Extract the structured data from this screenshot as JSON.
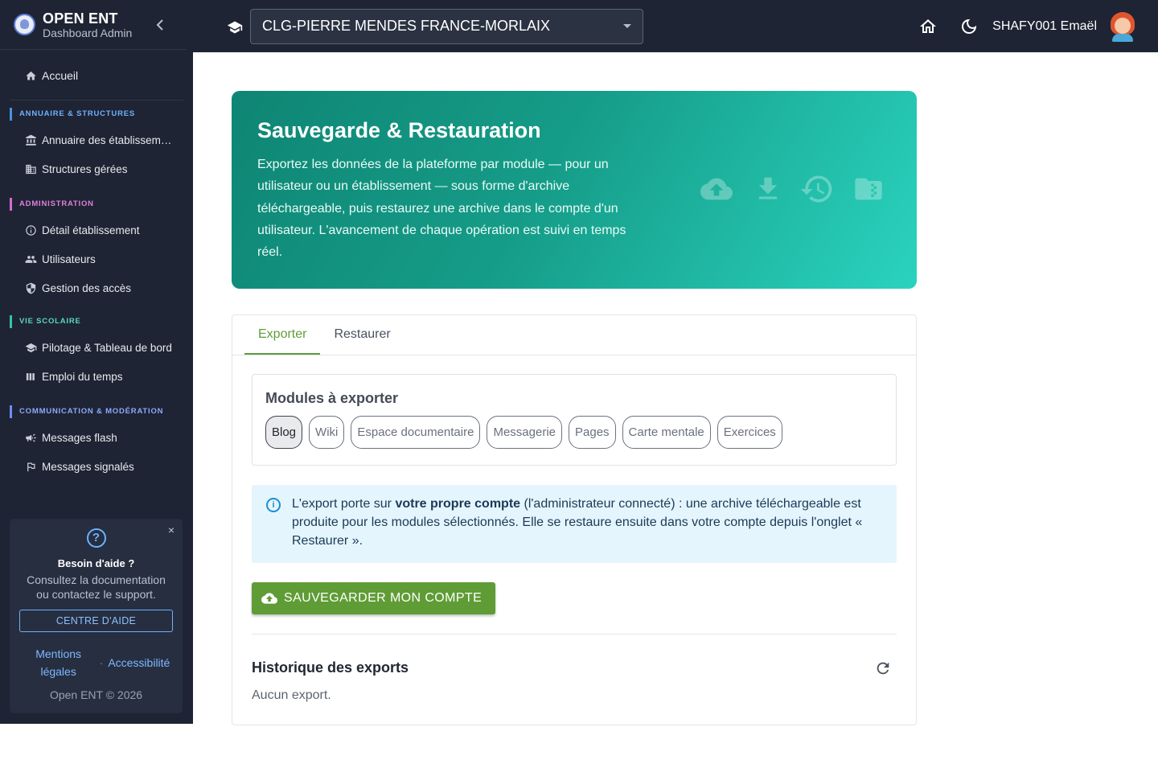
{
  "brand": {
    "title": "OPEN ENT",
    "subtitle": "Dashboard Admin"
  },
  "sidebar": {
    "home": "Accueil",
    "sections": {
      "annuaire": "ANNUAIRE & STRUCTURES",
      "admin": "ADMINISTRATION",
      "vie": "VIE SCOLAIRE",
      "comm": "COMMUNICATION & MODÉRATION"
    },
    "items": {
      "annuaire_etab": "Annuaire des établissem…",
      "structures": "Structures gérées",
      "detail_etab": "Détail établissement",
      "utilisateurs": "Utilisateurs",
      "gestion_acces": "Gestion des accès",
      "pilotage": "Pilotage & Tableau de bord",
      "emploi": "Emploi du temps",
      "messages_flash": "Messages flash",
      "messages_signales": "Messages signalés"
    }
  },
  "help": {
    "close": "×",
    "icon": "?",
    "title": "Besoin d'aide ?",
    "text": "Consultez la documentation ou contactez le support.",
    "button": "CENTRE D'AIDE",
    "link_mentions": "Mentions légales",
    "separator": "·",
    "link_access": "Accessibilité",
    "copyright": "Open ENT © 2026"
  },
  "topbar": {
    "school": "CLG-PIERRE MENDES FRANCE-MORLAIX",
    "user": "SHAFY001 Emaël"
  },
  "hero": {
    "title": "Sauvegarde & Restauration",
    "text": "Exportez les données de la plateforme par module — pour un utilisateur ou un établissement — sous forme d'archive téléchargeable, puis restaurez une archive dans le compte d'un utilisateur. L'avancement de chaque opération est suivi en temps réel."
  },
  "tabs": {
    "export": "Exporter",
    "restore": "Restaurer"
  },
  "modules": {
    "title": "Modules à exporter",
    "chips": {
      "blog": "Blog",
      "wiki": "Wiki",
      "espace": "Espace documentaire",
      "messagerie": "Messagerie",
      "pages": "Pages",
      "carte": "Carte mentale",
      "exercices": "Exercices"
    }
  },
  "info": {
    "icon": "i",
    "part1": "L'export porte sur ",
    "bold": "votre propre compte",
    "part2": " (l'administrateur connecté) : une archive téléchargeable est produite pour les modules sélectionnés. Elle se restaure ensuite dans votre compte depuis l'onglet « Restaurer »."
  },
  "actions": {
    "save": "SAUVEGARDER MON COMPTE"
  },
  "history": {
    "title": "Historique des exports",
    "empty": "Aucun export."
  },
  "colors": {
    "accent_green": "#5f9c35",
    "hero_start": "#0f8574",
    "hero_end": "#2ad3be",
    "sidebar_bg": "#1e2433"
  }
}
